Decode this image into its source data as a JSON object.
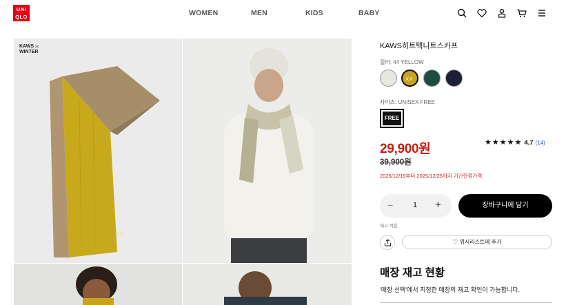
{
  "header": {
    "logo_line1": "UNI",
    "logo_line2": "QLO",
    "nav": [
      "WOMEN",
      "MEN",
      "KIDS",
      "BABY"
    ],
    "icons": [
      "search-icon",
      "heart-icon",
      "user-icon",
      "cart-icon",
      "menu-icon"
    ]
  },
  "gallery": {
    "badge_line1": "KAWS",
    "badge_mark": "xx",
    "badge_line2": "WINTER"
  },
  "product": {
    "name": "KAWS히트텍니트스카프",
    "color_label": "컬러: 44 YELLOW",
    "swatches": [
      {
        "name": "white",
        "color": "#e7e6df"
      },
      {
        "name": "yellow",
        "color": "#c9a21e"
      },
      {
        "name": "green",
        "color": "#1f4c3f"
      },
      {
        "name": "navy",
        "color": "#1b2037"
      }
    ],
    "size_label": "사이즈: UNISEX FREE",
    "size_value": "FREE",
    "price": "29,900원",
    "original_price": "39,900원",
    "promo": "2025/12/19부터 2025/12/25까지 기간한정가격",
    "rating_value": "4.7",
    "rating_count": "(14)",
    "stars": "★★★★★"
  },
  "purchase": {
    "minus": "−",
    "quantity": "1",
    "plus": "+",
    "cart_label": "장바구니에 담기",
    "stock_note": "재고 적음",
    "wishlist_label": "위시리스트에 추가"
  },
  "store": {
    "title": "매장 재고 현황",
    "description": "'매장 선택'에서 지정한 매장의 재고 확인이 가능합니다."
  }
}
